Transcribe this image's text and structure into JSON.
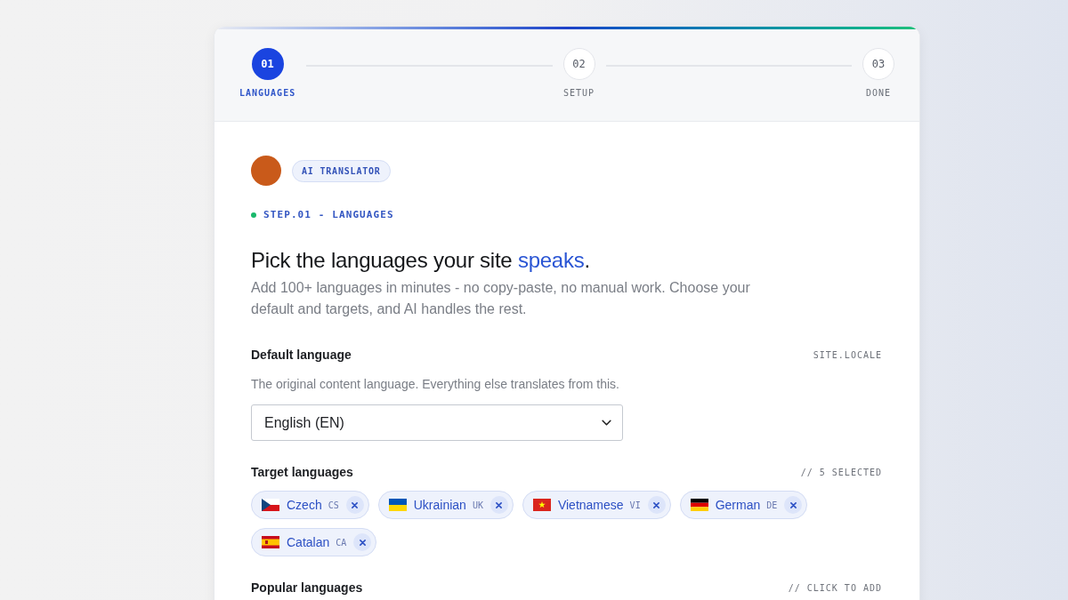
{
  "progress": {
    "steps": [
      {
        "number": "01",
        "label": "LANGUAGES",
        "selected": true
      },
      {
        "number": "02",
        "label": "SETUP",
        "selected": false
      },
      {
        "number": "03",
        "label": "DONE",
        "selected": false
      }
    ]
  },
  "intro": {
    "badge": "AI TRANSLATOR",
    "step_label": "STEP.01 - LANGUAGES",
    "heading": [
      {
        "text": "Pick the languages your site ",
        "highlight": false
      },
      {
        "text": "speaks",
        "highlight": true
      },
      {
        "text": ".",
        "highlight": false
      }
    ],
    "description": "Add 100+ languages in minutes - no copy-paste, no manual work. Choose your default and targets, and AI handles the rest."
  },
  "default_language": {
    "label": "Default language",
    "tag": "SITE.LOCALE",
    "hint": "The original content language. Everything else translates from this.",
    "value": "English (EN)"
  },
  "target_languages": {
    "label": "Target languages",
    "count": "// 5 SELECTED",
    "chips": [
      {
        "name": "Czech",
        "code": "CS",
        "kind": "cz"
      },
      {
        "name": "Ukrainian",
        "code": "UK",
        "kind": "ua"
      },
      {
        "name": "Vietnamese",
        "code": "VI",
        "kind": "vn"
      },
      {
        "name": "German",
        "code": "DE",
        "kind": "de"
      },
      {
        "name": "Catalan",
        "code": "CA",
        "kind": "es"
      }
    ]
  },
  "popular_languages": {
    "label": "Popular languages",
    "hint": "// CLICK TO ADD"
  }
}
